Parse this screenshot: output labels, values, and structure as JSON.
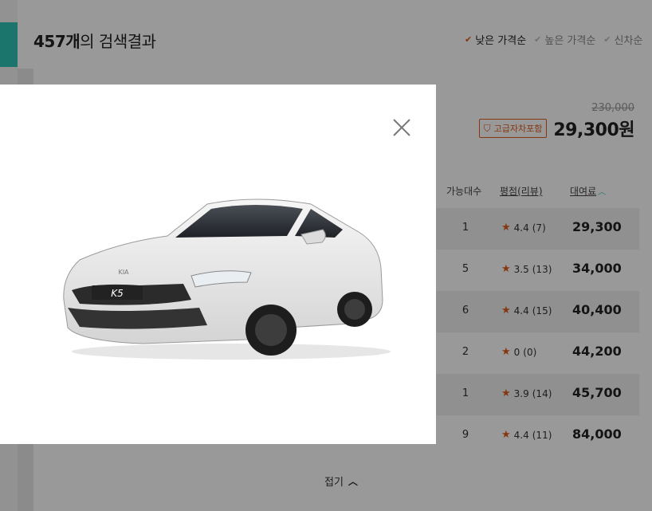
{
  "header": {
    "result_count": "457개",
    "result_suffix": "의 검색결과",
    "sort_options": [
      {
        "label": "낮은 가격순",
        "active": true
      },
      {
        "label": "높은 가격순",
        "active": false
      },
      {
        "label": "신차순",
        "active": false
      }
    ]
  },
  "listing": {
    "old_price": "230,000",
    "badge": "고급자차포함",
    "price": "29,300원",
    "columns": {
      "count": "가능대수",
      "rating": "평점(리뷰)",
      "rate": "대여료"
    },
    "rows": [
      {
        "count": "1",
        "rating": "4.4",
        "reviews": "(7)",
        "rate": "29,300"
      },
      {
        "count": "5",
        "rating": "3.5",
        "reviews": "(13)",
        "rate": "34,000"
      },
      {
        "count": "6",
        "rating": "4.4",
        "reviews": "(15)",
        "rate": "40,400"
      },
      {
        "count": "2",
        "rating": "0",
        "reviews": "(0)",
        "rate": "44,200"
      },
      {
        "count": "1",
        "rating": "3.9",
        "reviews": "(14)",
        "rate": "45,700"
      },
      {
        "count": "9",
        "rating": "4.4",
        "reviews": "(11)",
        "rate": "84,000"
      }
    ],
    "fold_label": "접기"
  },
  "modal": {
    "plate_text": "K5",
    "logo_text": "KIA"
  },
  "icons": {
    "close": "close-icon",
    "check": "check-icon",
    "star": "star-icon",
    "shield": "shield-icon",
    "chevron_up": "chevron-up-icon"
  },
  "colors": {
    "accent": "#2ec4b6",
    "highlight": "#e05a1c",
    "overlay": "rgba(0,0,0,0.4)"
  }
}
